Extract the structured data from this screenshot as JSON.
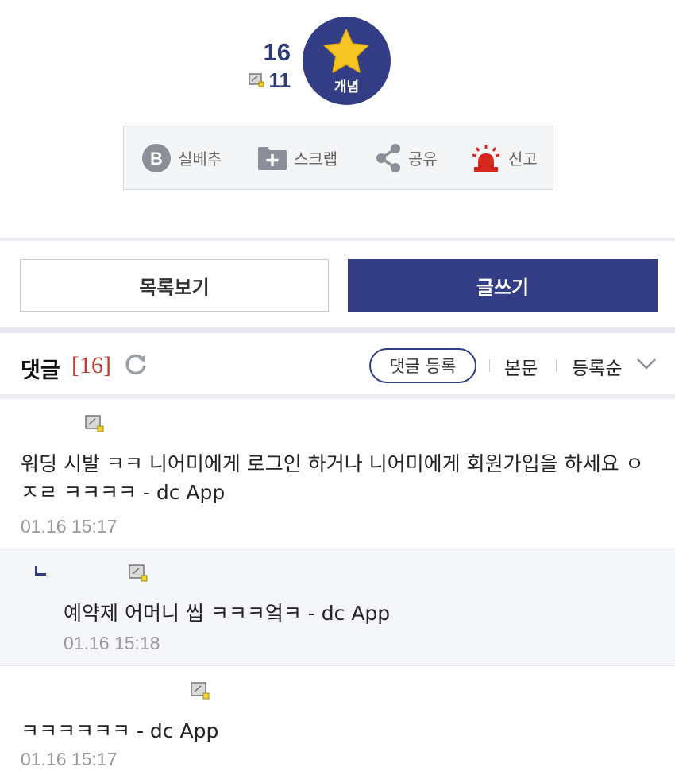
{
  "recommend": {
    "up_count": "16",
    "gall_count": "11",
    "up_label": "개념"
  },
  "actions": {
    "silbe": "실베추",
    "scrap": "스크랩",
    "share": "공유",
    "report": "신고"
  },
  "buttons": {
    "list": "목록보기",
    "write": "글쓰기"
  },
  "comments_header": {
    "title": "댓글",
    "count": "[16]",
    "register": "댓글 등록",
    "sort_body": "본문",
    "sort_order": "등록순"
  },
  "comments": [
    {
      "text": "워딩 시발 ㅋㅋ 니어미에게 로그인 하거나 니어미에게 회원가입을 하세요 ㅇㅈㄹ ㅋㅋㅋㅋ - dc App",
      "date": "01.16 15:17"
    },
    {
      "text": "예약제 어머니 씹 ㅋㅋㅋ엌ㅋ - dc App",
      "date": "01.16 15:18"
    },
    {
      "text": "ㅋㅋㅋㅋㅋㅋ - dc App",
      "date": "01.16 15:17"
    }
  ],
  "colors": {
    "accent": "#323d85",
    "count_red": "#c0392b",
    "star": "#f6c523",
    "alarm": "#d6281e"
  }
}
